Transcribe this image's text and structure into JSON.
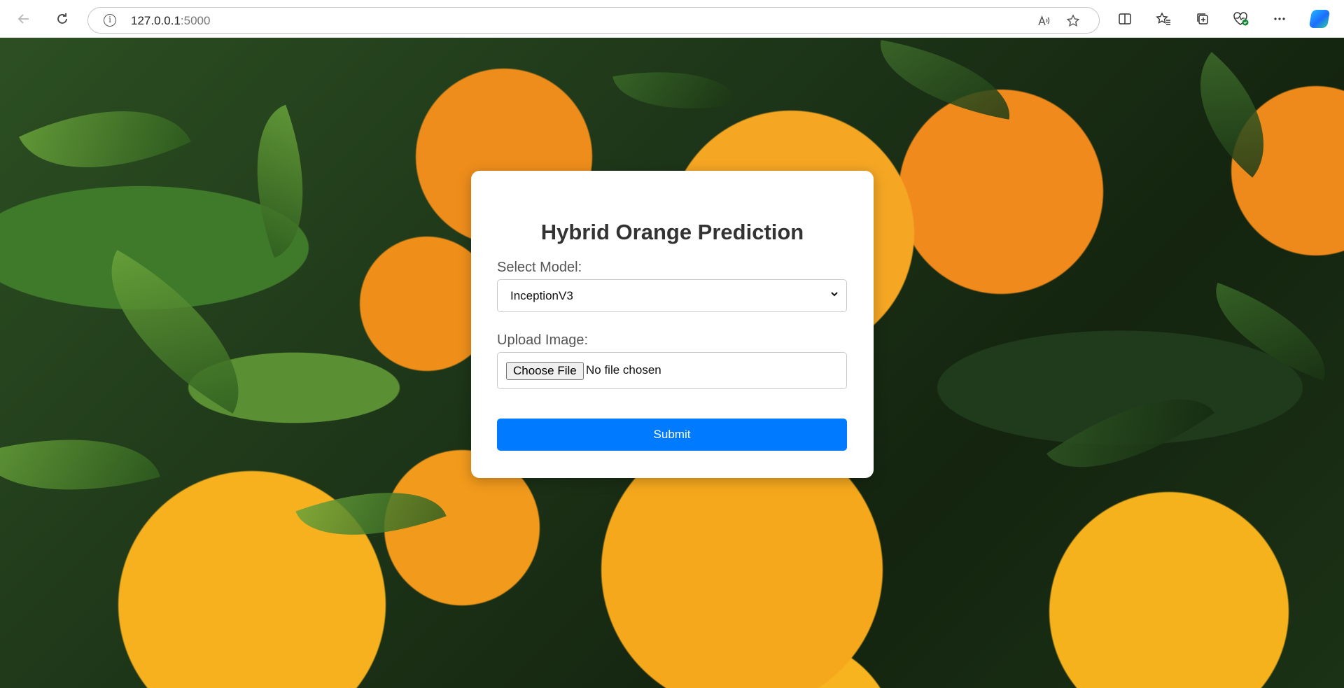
{
  "browser": {
    "url_host": "127.0.0.1",
    "url_port": ":5000",
    "icons": {
      "back": "back-arrow-icon",
      "refresh": "refresh-icon",
      "info": "info-icon",
      "read_aloud": "read-aloud-icon",
      "favorite": "star-icon",
      "split_screen": "split-screen-icon",
      "favorites": "favorites-icon",
      "collections": "collections-icon",
      "browser_essentials": "heart-pulse-icon",
      "more": "more-icon",
      "copilot": "copilot-icon"
    }
  },
  "form": {
    "title": "Hybrid Orange Prediction",
    "model_label": "Select Model:",
    "model_selected": "InceptionV3",
    "image_label": "Upload Image:",
    "choose_file_label": "Choose File",
    "no_file_text": "No file chosen",
    "submit_label": "Submit"
  },
  "colors": {
    "accent": "#007bff",
    "title": "#333333",
    "label": "#555555"
  }
}
